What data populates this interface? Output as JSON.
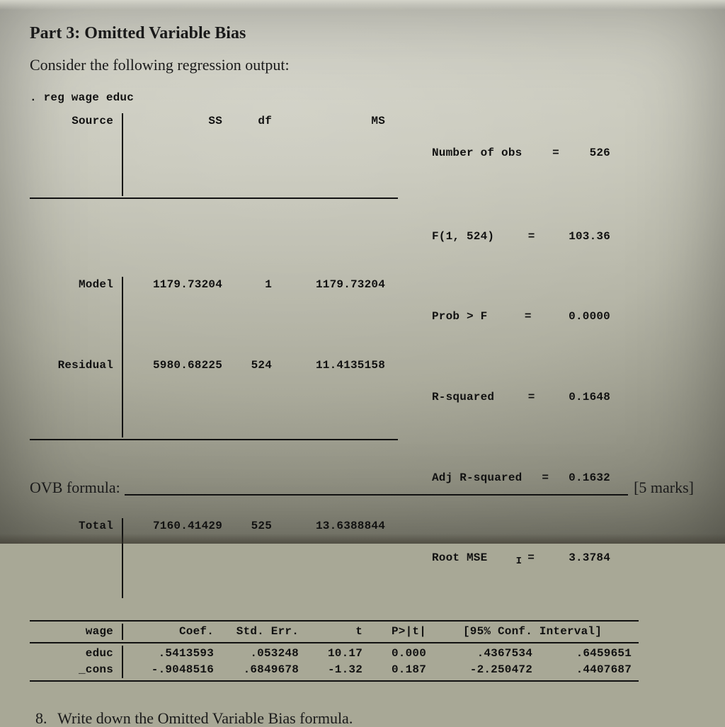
{
  "title": "Part 3: Omitted Variable Bias",
  "instruction": "Consider the following regression output:",
  "command": ". reg wage educ",
  "anova": {
    "headers": {
      "source": "Source",
      "ss": "SS",
      "df": "df",
      "ms": "MS"
    },
    "rows": [
      {
        "name": "Model",
        "ss": "1179.73204",
        "df": "1",
        "ms": "1179.73204"
      },
      {
        "name": "Residual",
        "ss": "5980.68225",
        "df": "524",
        "ms": "11.4135158"
      },
      {
        "name": "Total",
        "ss": "7160.41429",
        "df": "525",
        "ms": "13.6388844"
      }
    ]
  },
  "stats": [
    {
      "label": "Number of obs",
      "value": "526"
    },
    {
      "label": "F(1, 524)",
      "value": "103.36"
    },
    {
      "label": "Prob > F",
      "value": "0.0000"
    },
    {
      "label": "R-squared",
      "value": "0.1648"
    },
    {
      "label": "Adj R-squared",
      "value": "0.1632"
    },
    {
      "label": "Root MSE",
      "value": "3.3784"
    }
  ],
  "coef": {
    "depvar": "wage",
    "headers": {
      "coef": "Coef.",
      "se": "Std. Err.",
      "t": "t",
      "p": "P>|t|",
      "ci": "[95% Conf. Interval]"
    },
    "rows": [
      {
        "name": "educ",
        "coef": ".5413593",
        "se": ".053248",
        "t": "10.17",
        "p": "0.000",
        "lo": ".4367534",
        "hi": ".6459651"
      },
      {
        "name": "_cons",
        "coef": "-.9048516",
        "se": ".6849678",
        "t": "-1.32",
        "p": "0.187",
        "lo": "-2.250472",
        "hi": ".4407687"
      }
    ]
  },
  "q8_num": "8.",
  "q8_text": "Write down the Omitted Variable Bias formula.",
  "answer_prompt": "OVB formula:",
  "marks": "[5 marks]",
  "eq": "=",
  "cursor": "I"
}
